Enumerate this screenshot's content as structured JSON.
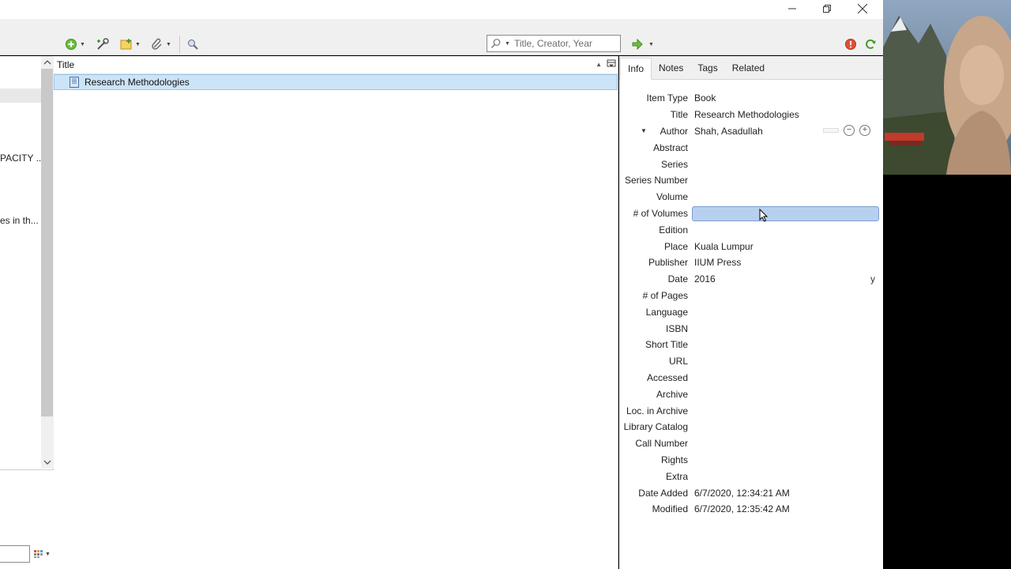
{
  "window": {
    "minimize_icon": "minimize-icon",
    "restore_icon": "restore-icon",
    "close_icon": "close-icon"
  },
  "toolbar": {
    "icons": [
      "new-item-icon",
      "add-by-identifier-icon",
      "new-note-icon",
      "attachment-icon",
      "locate-icon",
      "sync-error-icon",
      "sync-icon",
      "forward-arrow-icon"
    ],
    "search_placeholder": "Title, Creator, Year"
  },
  "left_pane": {
    "truncated_1": "PACITY ...",
    "truncated_2": "es in th..."
  },
  "items_pane": {
    "column_header": "Title",
    "rows": [
      {
        "title": "Research Methodologies",
        "selected": true
      }
    ]
  },
  "item_pane": {
    "tabs": [
      "Info",
      "Notes",
      "Tags",
      "Related"
    ],
    "active_tab": "Info",
    "fields": [
      {
        "label": "Item Type",
        "value": "Book"
      },
      {
        "label": "Title",
        "value": "Research Methodologies"
      },
      {
        "label": "Author",
        "value": "Shah, Asadullah"
      },
      {
        "label": "Abstract",
        "value": ""
      },
      {
        "label": "Series",
        "value": ""
      },
      {
        "label": "Series Number",
        "value": ""
      },
      {
        "label": "Volume",
        "value": ""
      },
      {
        "label": "# of Volumes",
        "value": ""
      },
      {
        "label": "Edition",
        "value": ""
      },
      {
        "label": "Place",
        "value": "Kuala Lumpur"
      },
      {
        "label": "Publisher",
        "value": "IIUM Press"
      },
      {
        "label": "Date",
        "value": "2016"
      },
      {
        "label": "# of Pages",
        "value": ""
      },
      {
        "label": "Language",
        "value": ""
      },
      {
        "label": "ISBN",
        "value": ""
      },
      {
        "label": "Short Title",
        "value": ""
      },
      {
        "label": "URL",
        "value": ""
      },
      {
        "label": "Accessed",
        "value": ""
      },
      {
        "label": "Archive",
        "value": ""
      },
      {
        "label": "Loc. in Archive",
        "value": ""
      },
      {
        "label": "Library Catalog",
        "value": ""
      },
      {
        "label": "Call Number",
        "value": ""
      },
      {
        "label": "Rights",
        "value": ""
      },
      {
        "label": "Extra",
        "value": ""
      },
      {
        "label": "Date Added",
        "value": "6/7/2020, 12:34:21 AM"
      },
      {
        "label": "Modified",
        "value": "6/7/2020, 12:35:42 AM"
      }
    ],
    "date_indicator": "y",
    "author_minus": "−",
    "author_plus": "+"
  },
  "colors": {
    "selection": "#cce4f7",
    "edit_field": "#b8d0f0",
    "toolbar_bg": "#f0f0f0"
  }
}
